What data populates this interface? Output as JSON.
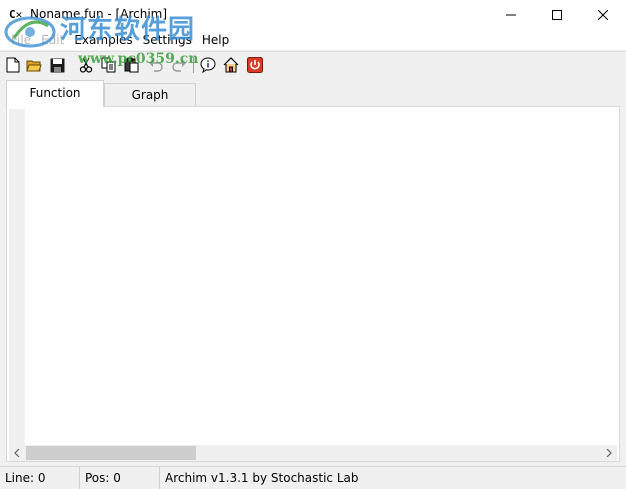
{
  "window": {
    "title": "Noname.fun - [Archim]",
    "app_icon_text": "C✕"
  },
  "watermark": {
    "name": "河东软件园",
    "url": "www.pc0359.cn"
  },
  "menu": {
    "items": [
      "File",
      "Edit",
      "Examples",
      "Settings",
      "Help"
    ]
  },
  "toolbar": {
    "icons": [
      "new-file-icon",
      "open-folder-icon",
      "save-icon",
      "cut-icon",
      "copy-icon",
      "paste-icon",
      "undo-icon",
      "redo-icon",
      "info-icon",
      "home-icon",
      "exit-icon"
    ]
  },
  "tabs": {
    "function": "Function",
    "graph": "Graph",
    "active": "Function"
  },
  "editor": {
    "content": ""
  },
  "status": {
    "line": "Line: 0",
    "pos": "Pos: 0",
    "about": "Archim v1.3.1 by Stochastic Lab"
  },
  "colors": {
    "accent_icon_red": "#d83b2a",
    "toolbar_folder": "#d8a22a",
    "watermark_blue": "#3a8fd4",
    "watermark_green": "#3aa03a"
  }
}
